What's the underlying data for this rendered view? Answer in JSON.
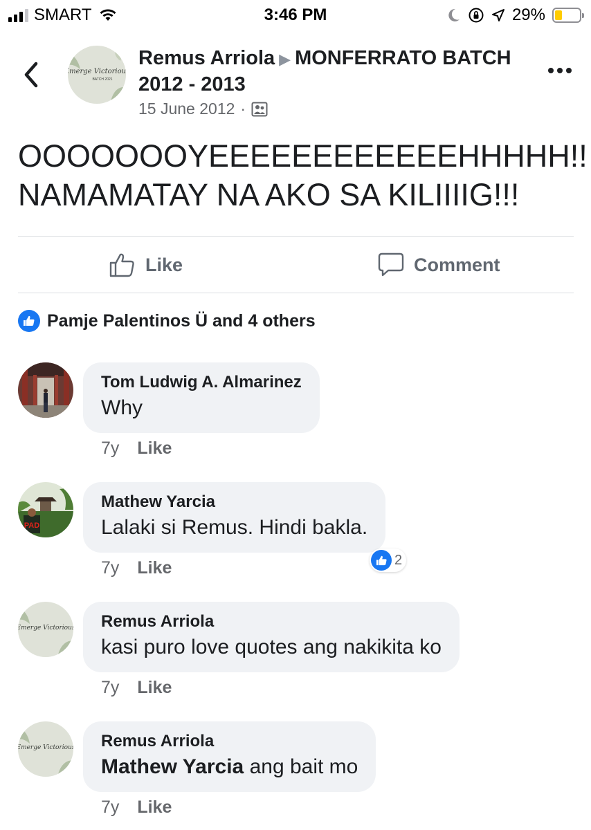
{
  "status_bar": {
    "carrier": "SMART",
    "time": "3:46 PM",
    "battery": "29%",
    "battery_level": 0.29,
    "battery_color": "#ffcc00",
    "icons": [
      "signal-icon",
      "wifi-icon",
      "moon-icon",
      "rotation-lock-icon",
      "location-arrow-icon",
      "battery-icon"
    ]
  },
  "header": {
    "author": "Remus Arriola",
    "separator_icon": "triangle-right-icon",
    "group": "MONFERRATO BATCH 2012 - 2013",
    "date": "15 June 2012",
    "dot": "·",
    "privacy_icon": "group-members-icon",
    "avatar_text_1": "Emerge Victorious",
    "avatar_text_2": "BATCH 2021"
  },
  "post": {
    "line1": "OOOOOOOYEEEEEEEEEEEEHHHHH!!",
    "line2": "NAMAMATAY NA AKO SA KILIIIIG!!!"
  },
  "actions": {
    "like_label": "Like",
    "comment_label": "Comment"
  },
  "reactions": {
    "summary": "Pamje Palentinos Ü and 4 others"
  },
  "comments": [
    {
      "name": "Tom Ludwig A. Almarinez",
      "text": "Why",
      "age": "7y",
      "like_label": "Like"
    },
    {
      "name": "Mathew Yarcia",
      "text": "Lalaki si Remus. Hindi bakla.",
      "age": "7y",
      "like_label": "Like",
      "reaction_count": "2"
    },
    {
      "name": "Remus Arriola",
      "text": "kasi puro love quotes ang nakikita ko",
      "age": "7y",
      "like_label": "Like"
    },
    {
      "name": "Remus Arriola",
      "mention": "Mathew Yarcia",
      "text": " ang bait mo",
      "age": "7y",
      "like_label": "Like"
    }
  ],
  "colors": {
    "accent": "#1877f2",
    "bubble": "#f0f2f5",
    "secondary_text": "#65676b"
  }
}
